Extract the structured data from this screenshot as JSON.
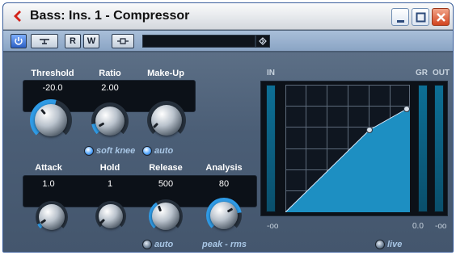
{
  "window": {
    "title": "Bass: Ins. 1 - Compressor",
    "icons": {
      "app": "cubase-arrow-icon",
      "minimize": "minimize-icon",
      "maximize": "maximize-icon",
      "close": "close-icon"
    }
  },
  "toolbar": {
    "power": "power-icon",
    "bypass": "bypass-icon",
    "read_label": "R",
    "write_label": "W",
    "routing": "routing-icon",
    "preset_value": "",
    "preset_menu_icon": "diamond-arrow-icon"
  },
  "controls": {
    "threshold": {
      "label": "Threshold",
      "value": "-20.0"
    },
    "ratio": {
      "label": "Ratio",
      "value": "2.00"
    },
    "makeup": {
      "label": "Make-Up",
      "value": ""
    },
    "attack": {
      "label": "Attack",
      "value": "1.0"
    },
    "hold": {
      "label": "Hold",
      "value": "1"
    },
    "release": {
      "label": "Release",
      "value": "500"
    },
    "analysis": {
      "label": "Analysis",
      "value": "80"
    }
  },
  "toggles": {
    "soft_knee": {
      "label": "soft knee",
      "on": true
    },
    "auto_makeup": {
      "label": "auto",
      "on": true
    },
    "auto_release": {
      "label": "auto",
      "on": false
    },
    "live": {
      "label": "live",
      "on": false
    }
  },
  "analysis_range_label": "peak - rms",
  "display": {
    "in_label": "IN",
    "gr_label": "GR",
    "out_label": "OUT",
    "in_min": "-oo",
    "gr_zero": "0.0",
    "out_min": "-oo"
  },
  "colors": {
    "curve_fill": "#1d8fc2",
    "grid": "#5d6a7a",
    "accent_ring": "#2f9be6"
  }
}
